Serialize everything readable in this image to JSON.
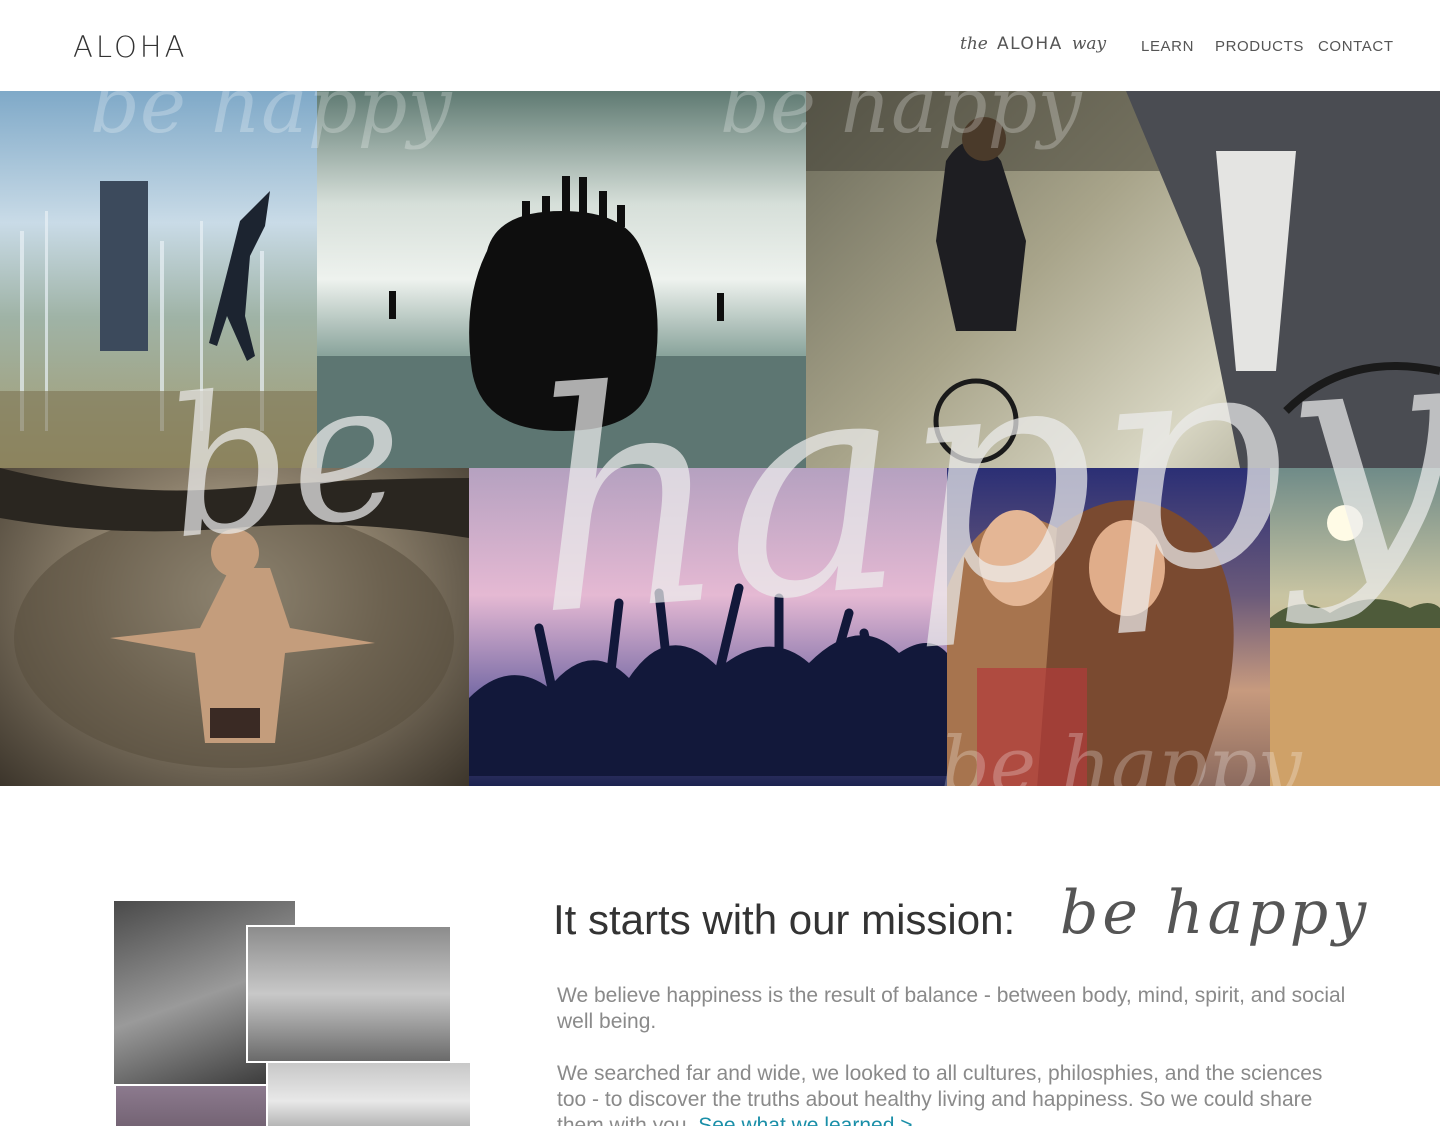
{
  "header": {
    "logo": "ALOHA",
    "aloha_way": {
      "prefix": "the",
      "brand": "ALOHA",
      "suffix": "way"
    },
    "nav": {
      "learn": "LEARN",
      "products": "PRODUCTS",
      "contact": "CONTACT"
    }
  },
  "hero": {
    "overlay_be": "be",
    "overlay_happy": "happy",
    "watermark_text": "be happy"
  },
  "mission": {
    "title": "It starts with our mission:",
    "script": "be happy",
    "paragraph1": "We believe happiness is the result of balance - between body, mind, spirit, and social well being.",
    "paragraph2": "We searched far and wide, we looked to all cultures, philosphies, and the sciences too - to discover the truths about healthy living and happiness. So we could share them with you.",
    "link": "See what we learned >"
  },
  "colors": {
    "link": "#1a8fa8",
    "body_text": "#8a8a8a",
    "heading": "#333333"
  }
}
